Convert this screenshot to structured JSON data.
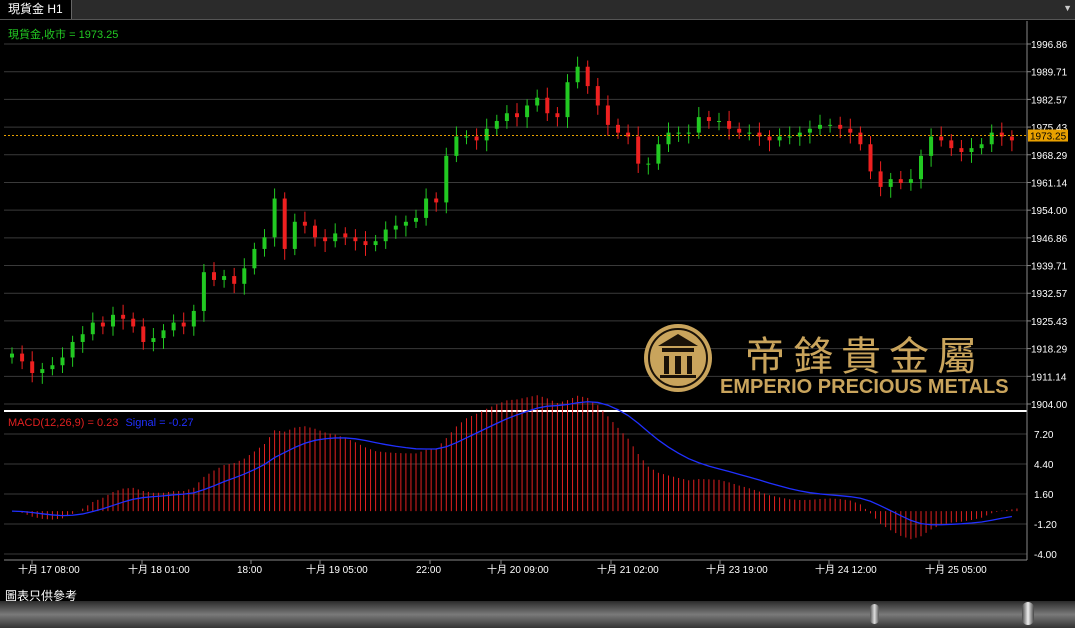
{
  "window": {
    "tab_title": "現貨金 H1"
  },
  "price_panel": {
    "label": "現貨金,收市 = 1973.25",
    "current_price": 1973.25,
    "current_price_label": "1973.25",
    "label_color": "#22c922",
    "current_line_color": "#e8a000"
  },
  "macd_panel": {
    "macd_label": "MACD(12,26,9) = 0.23",
    "signal_label": "Signal = -0.27",
    "macd_color": "#e02020",
    "signal_color": "#2030ff"
  },
  "watermark": {
    "chinese": "帝鋒貴金屬",
    "english": "EMPERIO PRECIOUS METALS",
    "color": "#c9a45c"
  },
  "footer": {
    "note": "圖表只供參考"
  },
  "chart_data": [
    {
      "type": "candlestick",
      "ylim": [
        1904.0,
        2000.0
      ],
      "y_ticks": [
        "1996.86",
        "1989.71",
        "1982.57",
        "1975.43",
        "1968.29",
        "1961.14",
        "1954.00",
        "1946.86",
        "1939.71",
        "1932.57",
        "1925.43",
        "1918.29",
        "1911.14",
        "1904.00"
      ],
      "x_tick_labels": [
        "十月 17 08:00",
        "十月 18 01:00",
        "18:00",
        "十月 19 05:00",
        "22:00",
        "十月 20 09:00",
        "十月 21 02:00",
        "十月 23 19:00",
        "十月 24 12:00",
        "十月 25 05:00"
      ],
      "up_color": "#22c922",
      "down_color": "#ee2020",
      "close_series": [
        1917,
        1915,
        1912,
        1913,
        1914,
        1916,
        1920,
        1922,
        1925,
        1924,
        1927,
        1926,
        1924,
        1920,
        1921,
        1923,
        1925,
        1924,
        1928,
        1938,
        1936,
        1937,
        1935,
        1939,
        1944,
        1947,
        1957,
        1944,
        1951,
        1950,
        1947,
        1946,
        1948,
        1947,
        1946,
        1945,
        1946,
        1949,
        1950,
        1951,
        1952,
        1957,
        1956,
        1968,
        1973,
        1973,
        1972,
        1975,
        1977,
        1979,
        1978,
        1981,
        1983,
        1979,
        1978,
        1987,
        1991,
        1986,
        1981,
        1976,
        1974,
        1973,
        1966,
        1966,
        1971,
        1974,
        1974,
        1974,
        1978,
        1977,
        1977,
        1975,
        1974,
        1974,
        1973,
        1972,
        1973,
        1973,
        1974,
        1975,
        1976,
        1976,
        1975,
        1974,
        1971,
        1964,
        1960,
        1962,
        1961,
        1962,
        1968,
        1973,
        1972,
        1970,
        1969,
        1970,
        1971,
        1974,
        1973,
        1972,
        1973,
        1973,
        1972,
        1972,
        1973.25
      ],
      "bar_stride": 5.05
    },
    {
      "type": "bar+line",
      "name": "MACD",
      "ylim": [
        -4.0,
        7.2
      ],
      "y_ticks": [
        "7.20",
        "4.40",
        "1.60",
        "-1.20",
        "-4.00"
      ],
      "macd": 0.23,
      "signal": -0.27
    }
  ]
}
